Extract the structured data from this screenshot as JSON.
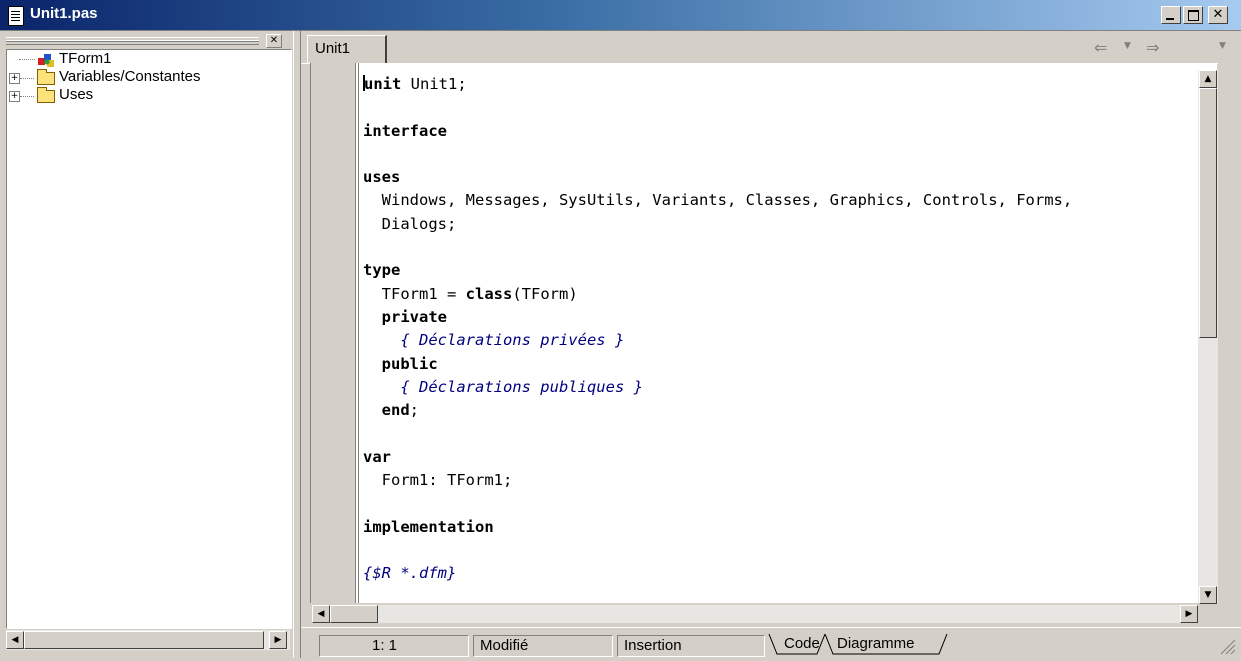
{
  "window": {
    "title": "Unit1.pas"
  },
  "explorer": {
    "items": [
      {
        "label": "TForm1",
        "icon": "form-icon"
      },
      {
        "label": "Variables/Constantes",
        "icon": "folder-icon"
      },
      {
        "label": "Uses",
        "icon": "folder-icon"
      }
    ]
  },
  "editor": {
    "tab_label": "Unit1",
    "lines": [
      [
        [
          "kw",
          "unit"
        ],
        [
          "t",
          " Unit1;"
        ]
      ],
      [],
      [
        [
          "kw",
          "interface"
        ]
      ],
      [],
      [
        [
          "kw",
          "uses"
        ]
      ],
      [
        [
          "t",
          "  Windows, Messages, SysUtils, Variants, Classes, Graphics, Controls, Forms,"
        ]
      ],
      [
        [
          "t",
          "  Dialogs;"
        ]
      ],
      [],
      [
        [
          "kw",
          "type"
        ]
      ],
      [
        [
          "t",
          "  TForm1 = "
        ],
        [
          "kw",
          "class"
        ],
        [
          "t",
          "(TForm)"
        ]
      ],
      [
        [
          "t",
          "  "
        ],
        [
          "kw",
          "private"
        ]
      ],
      [
        [
          "cm",
          "    { Déclarations privées }"
        ]
      ],
      [
        [
          "t",
          "  "
        ],
        [
          "kw",
          "public"
        ]
      ],
      [
        [
          "cm",
          "    { Déclarations publiques }"
        ]
      ],
      [
        [
          "t",
          "  "
        ],
        [
          "kw",
          "end"
        ],
        [
          "t",
          ";"
        ]
      ],
      [],
      [
        [
          "kw",
          "var"
        ]
      ],
      [
        [
          "t",
          "  Form1: TForm1;"
        ]
      ],
      [],
      [
        [
          "kw",
          "implementation"
        ]
      ],
      [],
      [
        [
          "cm",
          "{$R *.dfm}"
        ]
      ]
    ]
  },
  "status": {
    "position": "1:  1",
    "modified": "Modifié",
    "mode": "Insertion",
    "tab_code": "Code",
    "tab_diagram": "Diagramme"
  }
}
